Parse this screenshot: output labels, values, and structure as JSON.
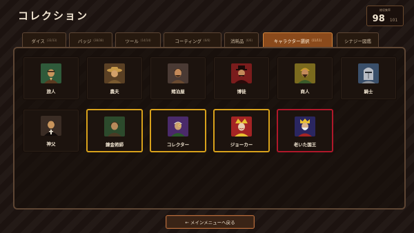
{
  "title": "コレクション",
  "score": {
    "label": "総収集率",
    "value": "98",
    "max": "101"
  },
  "tabs": [
    {
      "label": "ダイス",
      "count": "(33/33)",
      "active": false
    },
    {
      "label": "バッジ",
      "count": "(38/38)",
      "active": false
    },
    {
      "label": "ツール",
      "count": "(14/14)",
      "active": false
    },
    {
      "label": "コーティング",
      "count": "(6/6)",
      "active": false
    },
    {
      "label": "消耗品",
      "count": "(6/6)",
      "active": false
    },
    {
      "label": "キャラクター選択",
      "count": "(11/11)",
      "active": true
    },
    {
      "label": "シナジー図鑑",
      "count": "",
      "active": false
    }
  ],
  "characters": [
    {
      "name": "旅人",
      "icon": "traveler-portrait-icon",
      "bg": "#2f5a3a",
      "frame": "none"
    },
    {
      "name": "農夫",
      "icon": "farmer-portrait-icon",
      "bg": "#5a4024",
      "frame": "none"
    },
    {
      "name": "賭泊屋",
      "icon": "innkeeper-portrait-icon",
      "bg": "#4a3a34",
      "frame": "none"
    },
    {
      "name": "博徒",
      "icon": "gambler-portrait-icon",
      "bg": "#7a1c1c",
      "frame": "none"
    },
    {
      "name": "商人",
      "icon": "merchant-portrait-icon",
      "bg": "#7a6a1e",
      "frame": "none"
    },
    {
      "name": "騎士",
      "icon": "knight-portrait-icon",
      "bg": "#3a4f6a",
      "frame": "none"
    },
    {
      "name": "神父",
      "icon": "priest-portrait-icon",
      "bg": "#3a2c24",
      "frame": "none"
    },
    {
      "name": "錬金術師",
      "icon": "alchemist-portrait-icon",
      "bg": "#2c4a2c",
      "frame": "gold"
    },
    {
      "name": "コレクター",
      "icon": "collector-portrait-icon",
      "bg": "#4a2a6a",
      "frame": "gold"
    },
    {
      "name": "ジョーカー",
      "icon": "joker-portrait-icon",
      "bg": "#a42424",
      "frame": "gold"
    },
    {
      "name": "老いた国王",
      "icon": "old-king-portrait-icon",
      "bg": "#2a2660",
      "frame": "red"
    }
  ],
  "back_button": "← メインメニューへ戻る"
}
